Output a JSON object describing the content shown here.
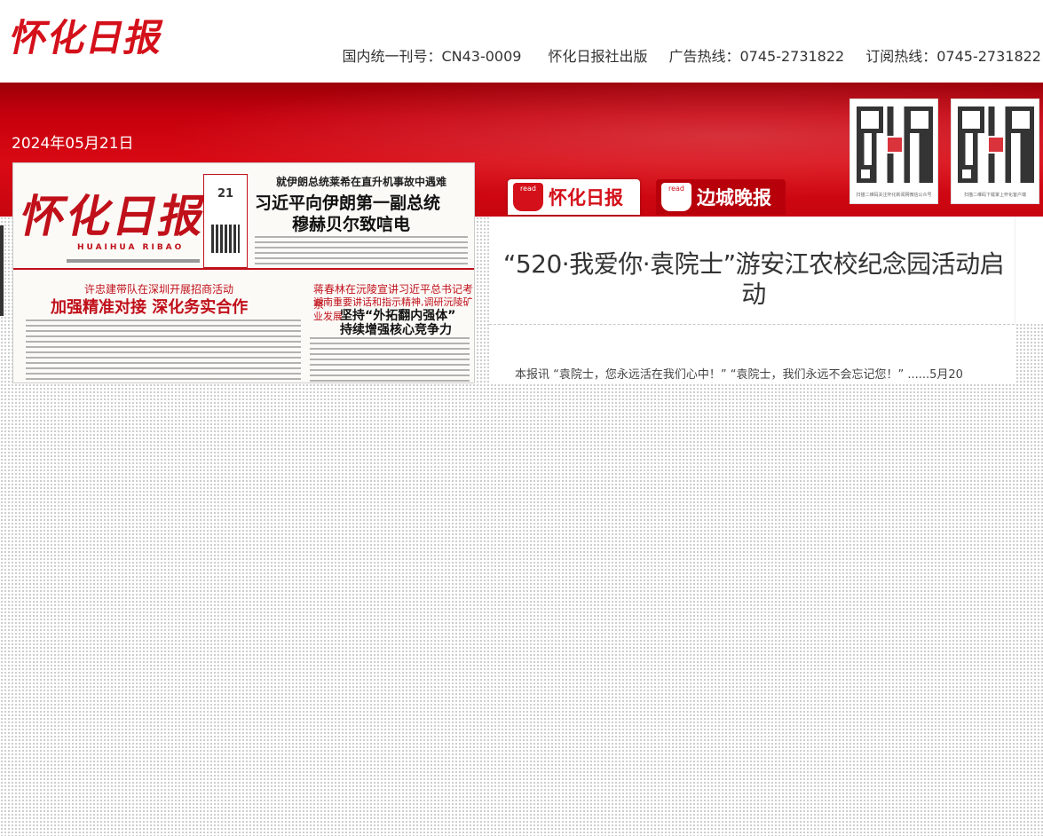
{
  "header": {
    "logo_text": "怀化日报",
    "issn": "国内统一刊号：CN43-0009",
    "publisher": "怀化日报社出版",
    "ad_hotline": "广告热线：0745-2731822",
    "subscribe_hotline": "订阅热线：0745-2731822"
  },
  "edition_date": "2024年05月21日",
  "qr_codes": [
    {
      "caption": "扫描二维码关注怀化新闻网微信公众号",
      "icon": "qr-code-icon"
    },
    {
      "caption": "扫描二维码下载掌上怀化客户端",
      "icon": "qr-code-icon"
    }
  ],
  "tabs": [
    {
      "read_label": "read",
      "name": "怀化日报"
    },
    {
      "read_label": "read",
      "name": "边城晚报"
    }
  ],
  "front_page": {
    "masthead": "怀化日报",
    "pinyin": "HUAIHUA  RIBAO",
    "date_box_day": "21",
    "kicker_top": "就伊朗总统莱希在直升机事故中遇难",
    "headline_top_1": "习近平向伊朗第一副总统",
    "headline_top_2": "穆赫贝尔致唁电",
    "kicker_left": "许忠建带队在深圳开展招商活动",
    "headline_left": "加强精准对接  深化务实合作",
    "kicker_right_1": "蒋春林在沅陵宣讲习近平总书记考察",
    "kicker_right_2": "湖南重要讲话和指示精神,调研沅陵矿业发展",
    "headline_right_1": "坚持“外拓翻内强体”",
    "headline_right_2": "持续增强核心竞争力"
  },
  "article": {
    "title": "“520·我爱你·袁院士”游安江农校纪念园活动启动",
    "summary": "本报讯  “袁院士，您永远活在我们心中！”  “袁院士，我们永远不会忘记您！”  ......5月20"
  },
  "colors": {
    "brand_red": "#d4101a",
    "band_red": "#c6000d"
  }
}
